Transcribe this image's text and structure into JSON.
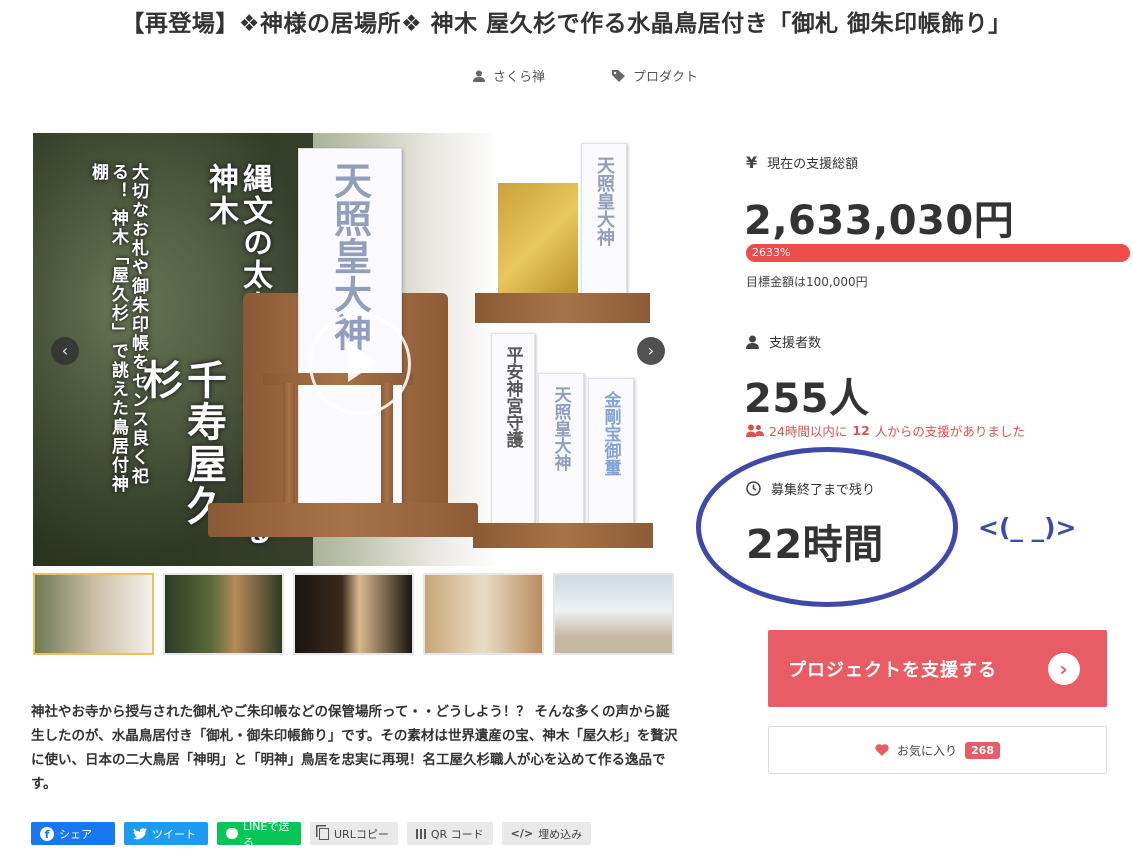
{
  "title": "【再登場】❖神様の居場所❖ 神木 屋久杉で作る水晶鳥居付き「御札 御朱印帳飾り」",
  "meta": {
    "author": "さくら禅",
    "category": "プロダクト"
  },
  "hero": {
    "overlay_line1": "大切なお札や御朱印帳をセンス良く祀る！ 神木「屋久杉」で誂えた鳥居付神棚",
    "overlay_big": "千寿屋久杉",
    "overlay_line2": "縄文の太古より生き続ける神木",
    "ofuda_main": "天照皇大神",
    "ofuda_small1": "天照皇大神",
    "ofuda_small2": "平安神宮守護",
    "ofuda_small3": "天照皇大神",
    "ofuda_small4": "金剛宝御璽",
    "thumbnail_count": 5,
    "active_thumbnail": 1
  },
  "description": "神社やお寺から授与された御札やご朱印帳などの保管場所って・・どうしよう！？ そんな多くの声から誕生したのが、水晶鳥居付き「御札・御朱印帳飾り」です。その素材は世界遺産の宝、神木「屋久杉」を贅沢に使い、日本の二大鳥居「神明」と「明神」鳥居を忠実に再現！名工屋久杉職人が心を込めて作る逸品です。",
  "share": {
    "facebook": "シェア",
    "twitter": "ツイート",
    "line": "LINEで送る",
    "url_copy": "URLコピー",
    "qr": "QR コード",
    "embed": "埋め込み"
  },
  "funding": {
    "currency_symbol": "¥",
    "total_label": "現在の支援総額",
    "total_value": "2,633,030円",
    "percent": "2633%",
    "goal": "目標金額は100,000円",
    "backers_label": "支援者数",
    "backers_value": "255人",
    "recent_prefix": "24時間以内に",
    "recent_count": "12",
    "recent_suffix": "人からの支援がありました",
    "remaining_label": "募集終了まで残り",
    "remaining_value": "22時間",
    "annotation": "<(_ _)>"
  },
  "actions": {
    "support_label": "プロジェクトを支援する",
    "favorite_label": "お気に入り",
    "favorite_count": "268"
  },
  "colors": {
    "accent": "#e85d65",
    "progress": "#ee4b4b",
    "annotation": "#3f4aa8"
  }
}
